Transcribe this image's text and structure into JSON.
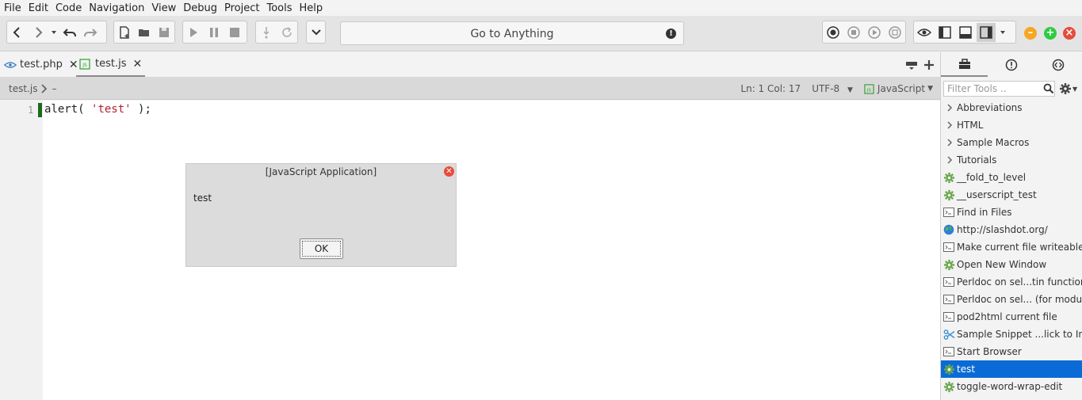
{
  "menu": {
    "items": [
      {
        "label": "File"
      },
      {
        "label": "Edit"
      },
      {
        "label": "Code"
      },
      {
        "label": "Navigation"
      },
      {
        "label": "View"
      },
      {
        "label": "Debug"
      },
      {
        "label": "Project"
      },
      {
        "label": "Tools"
      },
      {
        "label": "Help"
      }
    ]
  },
  "toolbar": {
    "goto_placeholder": "Go to Anything",
    "goto_warning": "!"
  },
  "tabs": [
    {
      "label": "test.php",
      "icon": "eye-icon"
    },
    {
      "label": "test.js",
      "icon": "js-file-icon",
      "active": true
    }
  ],
  "breadcrumb": {
    "file": "test.js",
    "symbol": "–"
  },
  "status": {
    "position": "Ln: 1 Col: 17",
    "encoding": "UTF-8",
    "language": "JavaScript"
  },
  "editor": {
    "line_number": "1",
    "code_prefix": "alert( ",
    "code_string": "'test'",
    "code_suffix": " );"
  },
  "dialog": {
    "title": "[JavaScript Application]",
    "message": "test",
    "ok_label": "OK"
  },
  "toolbox": {
    "filter_placeholder": "Filter Tools ..",
    "items": [
      {
        "label": "Abbreviations",
        "type": "folder"
      },
      {
        "label": "HTML",
        "type": "folder"
      },
      {
        "label": "Sample Macros",
        "type": "folder"
      },
      {
        "label": "Tutorials",
        "type": "folder"
      },
      {
        "label": "__fold_to_level",
        "type": "macro"
      },
      {
        "label": "__userscript_test",
        "type": "macro"
      },
      {
        "label": "Find in Files",
        "type": "command"
      },
      {
        "label": "http://slashdot.org/",
        "type": "url"
      },
      {
        "label": "Make current file writeable",
        "type": "command"
      },
      {
        "label": "Open New Window",
        "type": "macro"
      },
      {
        "label": "Perldoc on sel...tin functions)",
        "type": "command"
      },
      {
        "label": "Perldoc on sel... (for modules)",
        "type": "command"
      },
      {
        "label": "pod2html current file",
        "type": "command"
      },
      {
        "label": "Sample Snippet ...lick to Insert",
        "type": "snippet"
      },
      {
        "label": "Start Browser",
        "type": "command"
      },
      {
        "label": "test",
        "type": "macro",
        "selected": true
      },
      {
        "label": "toggle-word-wrap-edit",
        "type": "macro"
      }
    ]
  },
  "colors": {
    "selection": "#0a6bd6",
    "caret_mark": "#1b6a1b",
    "string": "#b4212b",
    "close_red": "#e74c3c",
    "minimize_orange": "#f5a623",
    "maximize_green": "#2ecc40"
  }
}
